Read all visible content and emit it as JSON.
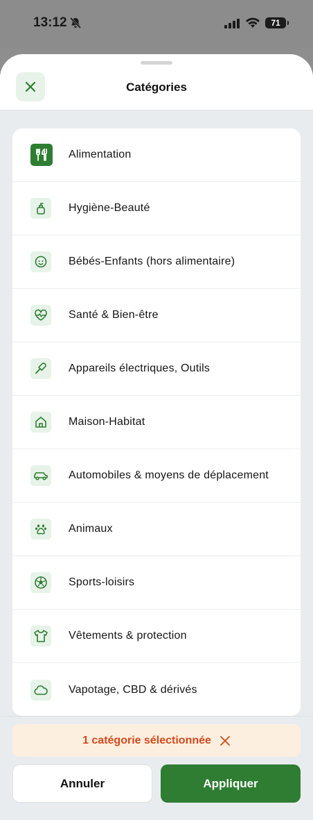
{
  "status_bar": {
    "time": "13:12",
    "battery": "71"
  },
  "sheet": {
    "title": "Catégories",
    "close_icon": "close-icon"
  },
  "categories": [
    {
      "label": "Alimentation",
      "icon": "fork-knife-icon",
      "selected": true
    },
    {
      "label": "Hygiène-Beauté",
      "icon": "soap-bottle-icon",
      "selected": false
    },
    {
      "label": "Bébés-Enfants (hors alimentaire)",
      "icon": "baby-face-icon",
      "selected": false
    },
    {
      "label": "Santé & Bien-être",
      "icon": "heart-pulse-icon",
      "selected": false
    },
    {
      "label": "Appareils électriques, Outils",
      "icon": "tool-icon",
      "selected": false
    },
    {
      "label": "Maison-Habitat",
      "icon": "house-icon",
      "selected": false
    },
    {
      "label": "Automobiles & moyens de déplacement",
      "icon": "car-icon",
      "selected": false
    },
    {
      "label": "Animaux",
      "icon": "paw-icon",
      "selected": false
    },
    {
      "label": "Sports-loisirs",
      "icon": "soccer-ball-icon",
      "selected": false
    },
    {
      "label": "Vêtements & protection",
      "icon": "tshirt-icon",
      "selected": false
    },
    {
      "label": "Vapotage, CBD & dérivés",
      "icon": "cloud-icon",
      "selected": false
    }
  ],
  "selection_banner": {
    "text": "1 catégorie sélectionnée"
  },
  "actions": {
    "cancel_label": "Annuler",
    "apply_label": "Appliquer"
  },
  "colors": {
    "brand_green": "#2e7d32",
    "icon_bg": "#e7f3e8",
    "banner_bg": "#fdefe0",
    "banner_text": "#d44a1c"
  }
}
